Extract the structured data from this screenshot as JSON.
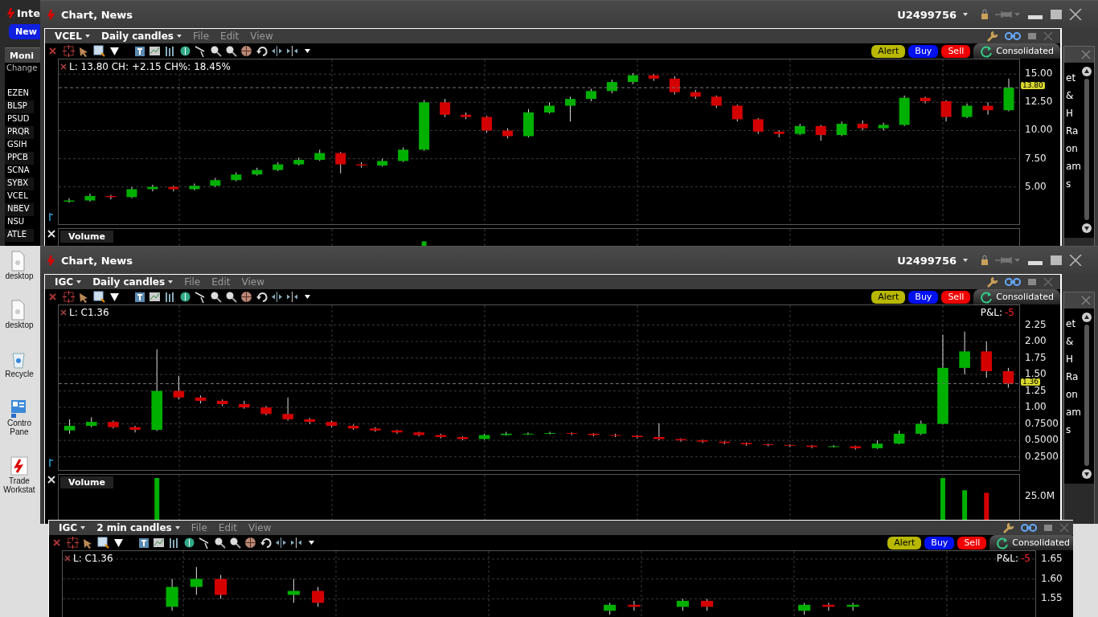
{
  "back_window": {
    "title": "Inte",
    "button": "New",
    "header": "Moni",
    "subheader": "Change",
    "tickers": [
      "EZEN",
      "BLSP",
      "PSUD",
      "PRQR",
      "GSIH",
      "PPCB",
      "SCNA",
      "SYBX",
      "VCEL",
      "NBEV",
      "NSU",
      "ATLE"
    ]
  },
  "desktop_icons": [
    {
      "kind": "file",
      "label": "desktop"
    },
    {
      "kind": "file",
      "label": "desktop"
    },
    {
      "kind": "recycle",
      "label": "Recycle"
    },
    {
      "kind": "control",
      "label": "Contro Pane"
    },
    {
      "kind": "app",
      "label": "Trade Workstat"
    }
  ],
  "windows": [
    {
      "title": "Chart, News",
      "account": "U2499756",
      "chart": {
        "symbol": "VCEL",
        "interval": "Daily candles",
        "menus": [
          "File",
          "Edit",
          "View"
        ],
        "actions": [
          "Alert",
          "Buy",
          "Sell"
        ],
        "feed": "Consolidated",
        "legend": "L: 13.80 CH: +2.15 CH%: 18.45%",
        "volume": {
          "label": "Volume"
        },
        "chart_data": {
          "type": "candlestick",
          "grid": true,
          "ref_lines": [
            {
              "axis": "y",
              "value": 13.8,
              "label": "13.80"
            }
          ],
          "ylim": [
            1.7,
            16.3
          ],
          "yticks": [
            {
              "value": 15,
              "label": "15.00"
            },
            {
              "value": 12.5,
              "label": "12.50"
            },
            {
              "value": 10,
              "label": "10.00"
            },
            {
              "value": 7.5,
              "label": "7.50"
            },
            {
              "value": 5,
              "label": "5.00"
            }
          ],
          "ohlc": [
            [
              3.7,
              4.0,
              3.6,
              3.8
            ],
            [
              3.8,
              4.4,
              3.7,
              4.2
            ],
            [
              4.2,
              4.3,
              3.9,
              4.1
            ],
            [
              4.1,
              5.0,
              4.0,
              4.8
            ],
            [
              4.8,
              5.2,
              4.6,
              5.0
            ],
            [
              5.0,
              5.1,
              4.6,
              4.8
            ],
            [
              4.8,
              5.3,
              4.7,
              5.1
            ],
            [
              5.1,
              5.8,
              5.0,
              5.6
            ],
            [
              5.6,
              6.3,
              5.5,
              6.1
            ],
            [
              6.1,
              6.7,
              6.0,
              6.5
            ],
            [
              6.5,
              7.2,
              6.4,
              7.0
            ],
            [
              7.0,
              7.6,
              6.9,
              7.4
            ],
            [
              7.4,
              8.3,
              7.3,
              8.0
            ],
            [
              8.0,
              8.1,
              6.2,
              7.0
            ],
            [
              7.0,
              7.2,
              6.7,
              6.9
            ],
            [
              6.9,
              7.5,
              6.8,
              7.3
            ],
            [
              7.3,
              8.5,
              7.2,
              8.3
            ],
            [
              8.3,
              12.7,
              8.2,
              12.5
            ],
            [
              12.5,
              12.8,
              11.2,
              11.4
            ],
            [
              11.4,
              11.6,
              11.0,
              11.2
            ],
            [
              11.2,
              11.3,
              9.8,
              10.0
            ],
            [
              10.0,
              10.2,
              9.3,
              9.5
            ],
            [
              9.5,
              11.9,
              9.4,
              11.6
            ],
            [
              11.6,
              12.5,
              11.5,
              12.2
            ],
            [
              12.2,
              13.0,
              10.8,
              12.8
            ],
            [
              12.8,
              13.7,
              12.6,
              13.5
            ],
            [
              13.5,
              14.5,
              13.3,
              14.3
            ],
            [
              14.3,
              15.1,
              14.1,
              14.9
            ],
            [
              14.9,
              15.0,
              14.4,
              14.6
            ],
            [
              14.6,
              14.8,
              13.2,
              13.4
            ],
            [
              13.4,
              13.6,
              12.8,
              13.0
            ],
            [
              13.0,
              13.1,
              12.0,
              12.2
            ],
            [
              12.2,
              12.3,
              10.8,
              11.0
            ],
            [
              11.0,
              11.1,
              9.7,
              9.9
            ],
            [
              9.9,
              10.0,
              9.4,
              9.7
            ],
            [
              9.7,
              10.6,
              9.6,
              10.4
            ],
            [
              10.4,
              10.5,
              9.1,
              9.6
            ],
            [
              9.6,
              10.8,
              9.5,
              10.6
            ],
            [
              10.6,
              10.9,
              10.0,
              10.2
            ],
            [
              10.2,
              10.7,
              10.0,
              10.5
            ],
            [
              10.5,
              13.1,
              10.4,
              12.9
            ],
            [
              12.9,
              13.0,
              12.4,
              12.6
            ],
            [
              12.6,
              12.7,
              10.8,
              11.2
            ],
            [
              11.2,
              12.4,
              11.1,
              12.2
            ],
            [
              12.2,
              12.5,
              11.4,
              11.8
            ],
            [
              11.8,
              14.6,
              11.7,
              13.8
            ]
          ]
        }
      },
      "side_panel": {
        "lines": [
          "et",
          "&",
          "H",
          "Ra",
          "on",
          "am",
          "s"
        ]
      }
    },
    {
      "title": "Chart, News",
      "account": "U2499756",
      "chart": {
        "symbol": "IGC",
        "interval": "Daily candles",
        "menus": [
          "File",
          "Edit",
          "View"
        ],
        "actions": [
          "Alert",
          "Buy",
          "Sell"
        ],
        "feed": "Consolidated",
        "legend": "L: C1.36",
        "pnl_label": "P&L:",
        "pnl_value": "-5",
        "volume": {
          "label": "Volume",
          "tick": "25.0M"
        },
        "chart_data": {
          "type": "candlestick",
          "grid": true,
          "ref_lines": [
            {
              "axis": "y",
              "value": 1.36,
              "label": "1.36"
            }
          ],
          "ylim": [
            0.05,
            2.55
          ],
          "yticks": [
            {
              "value": 2.25,
              "label": "2.25"
            },
            {
              "value": 2.0,
              "label": "2.00"
            },
            {
              "value": 1.75,
              "label": "1.75"
            },
            {
              "value": 1.5,
              "label": "1.50"
            },
            {
              "value": 1.25,
              "label": "1.25"
            },
            {
              "value": 1.0,
              "label": "1.00"
            },
            {
              "value": 0.75,
              "label": "0.7500"
            },
            {
              "value": 0.5,
              "label": "0.5000"
            },
            {
              "value": 0.25,
              "label": "0.2500"
            }
          ],
          "ohlc": [
            [
              0.65,
              0.82,
              0.6,
              0.72
            ],
            [
              0.72,
              0.85,
              0.7,
              0.78
            ],
            [
              0.78,
              0.8,
              0.68,
              0.7
            ],
            [
              0.7,
              0.72,
              0.62,
              0.66
            ],
            [
              0.66,
              1.88,
              0.64,
              1.25
            ],
            [
              1.25,
              1.48,
              1.12,
              1.15
            ],
            [
              1.15,
              1.18,
              1.06,
              1.1
            ],
            [
              1.1,
              1.12,
              1.02,
              1.05
            ],
            [
              1.05,
              1.1,
              0.98,
              1.0
            ],
            [
              1.0,
              1.02,
              0.88,
              0.9
            ],
            [
              0.9,
              1.15,
              0.8,
              0.82
            ],
            [
              0.82,
              0.84,
              0.75,
              0.78
            ],
            [
              0.78,
              0.8,
              0.7,
              0.72
            ],
            [
              0.72,
              0.74,
              0.66,
              0.68
            ],
            [
              0.68,
              0.7,
              0.63,
              0.65
            ],
            [
              0.65,
              0.66,
              0.6,
              0.62
            ],
            [
              0.62,
              0.63,
              0.56,
              0.58
            ],
            [
              0.58,
              0.6,
              0.53,
              0.55
            ],
            [
              0.55,
              0.56,
              0.5,
              0.52
            ],
            [
              0.52,
              0.6,
              0.51,
              0.58
            ],
            [
              0.58,
              0.63,
              0.57,
              0.6
            ],
            [
              0.6,
              0.62,
              0.58,
              0.6
            ],
            [
              0.6,
              0.63,
              0.59,
              0.61
            ],
            [
              0.61,
              0.62,
              0.58,
              0.6
            ],
            [
              0.6,
              0.61,
              0.56,
              0.58
            ],
            [
              0.58,
              0.6,
              0.55,
              0.57
            ],
            [
              0.57,
              0.58,
              0.53,
              0.55
            ],
            [
              0.55,
              0.76,
              0.5,
              0.52
            ],
            [
              0.52,
              0.53,
              0.48,
              0.5
            ],
            [
              0.5,
              0.51,
              0.46,
              0.48
            ],
            [
              0.48,
              0.49,
              0.44,
              0.46
            ],
            [
              0.46,
              0.47,
              0.42,
              0.44
            ],
            [
              0.44,
              0.45,
              0.41,
              0.43
            ],
            [
              0.43,
              0.44,
              0.4,
              0.42
            ],
            [
              0.42,
              0.43,
              0.38,
              0.4
            ],
            [
              0.4,
              0.43,
              0.39,
              0.41
            ],
            [
              0.41,
              0.42,
              0.36,
              0.38
            ],
            [
              0.38,
              0.5,
              0.37,
              0.45
            ],
            [
              0.45,
              0.65,
              0.44,
              0.6
            ],
            [
              0.6,
              0.8,
              0.58,
              0.75
            ],
            [
              0.75,
              2.1,
              0.74,
              1.6
            ],
            [
              1.6,
              2.15,
              1.5,
              1.85
            ],
            [
              1.85,
              2.0,
              1.45,
              1.55
            ],
            [
              1.55,
              1.6,
              1.3,
              1.36
            ]
          ]
        }
      },
      "side_panel": {
        "lines": [
          "et",
          "&",
          "H",
          "Ra",
          "on",
          "am",
          "s"
        ]
      }
    },
    {
      "chart": {
        "symbol": "IGC",
        "interval": "2 min candles",
        "menus": [
          "File",
          "Edit",
          "View"
        ],
        "actions": [
          "Alert",
          "Buy",
          "Sell"
        ],
        "feed": "Consolidated",
        "legend": "L: C1.36",
        "pnl_label": "P&L:",
        "pnl_value": "-5",
        "chart_data": {
          "type": "candlestick",
          "grid": true,
          "ylim": [
            1.27,
            1.67
          ],
          "yticks": [
            {
              "value": 1.65,
              "label": "1.65"
            },
            {
              "value": 1.6,
              "label": "1.60"
            },
            {
              "value": 1.55,
              "label": "1.55"
            }
          ],
          "ohlc": [
            null,
            null,
            null,
            null,
            [
              1.53,
              1.6,
              1.52,
              1.58
            ],
            [
              1.58,
              1.63,
              1.56,
              1.6
            ],
            [
              1.6,
              1.61,
              1.55,
              1.56
            ],
            null,
            null,
            [
              1.56,
              1.6,
              1.54,
              1.57
            ],
            [
              1.57,
              1.58,
              1.53,
              1.54
            ],
            null,
            null,
            null,
            null,
            null,
            null,
            null,
            null,
            null,
            null,
            null,
            [
              1.52,
              1.54,
              1.51,
              1.535
            ],
            [
              1.535,
              1.545,
              1.52,
              1.53
            ],
            null,
            [
              1.53,
              1.55,
              1.52,
              1.545
            ],
            [
              1.545,
              1.55,
              1.52,
              1.53
            ],
            null,
            null,
            null,
            [
              1.52,
              1.54,
              1.51,
              1.535
            ],
            [
              1.535,
              1.54,
              1.52,
              1.53
            ],
            [
              1.53,
              1.54,
              1.52,
              1.535
            ],
            null,
            null,
            null,
            null,
            null,
            null,
            null
          ]
        }
      }
    }
  ]
}
